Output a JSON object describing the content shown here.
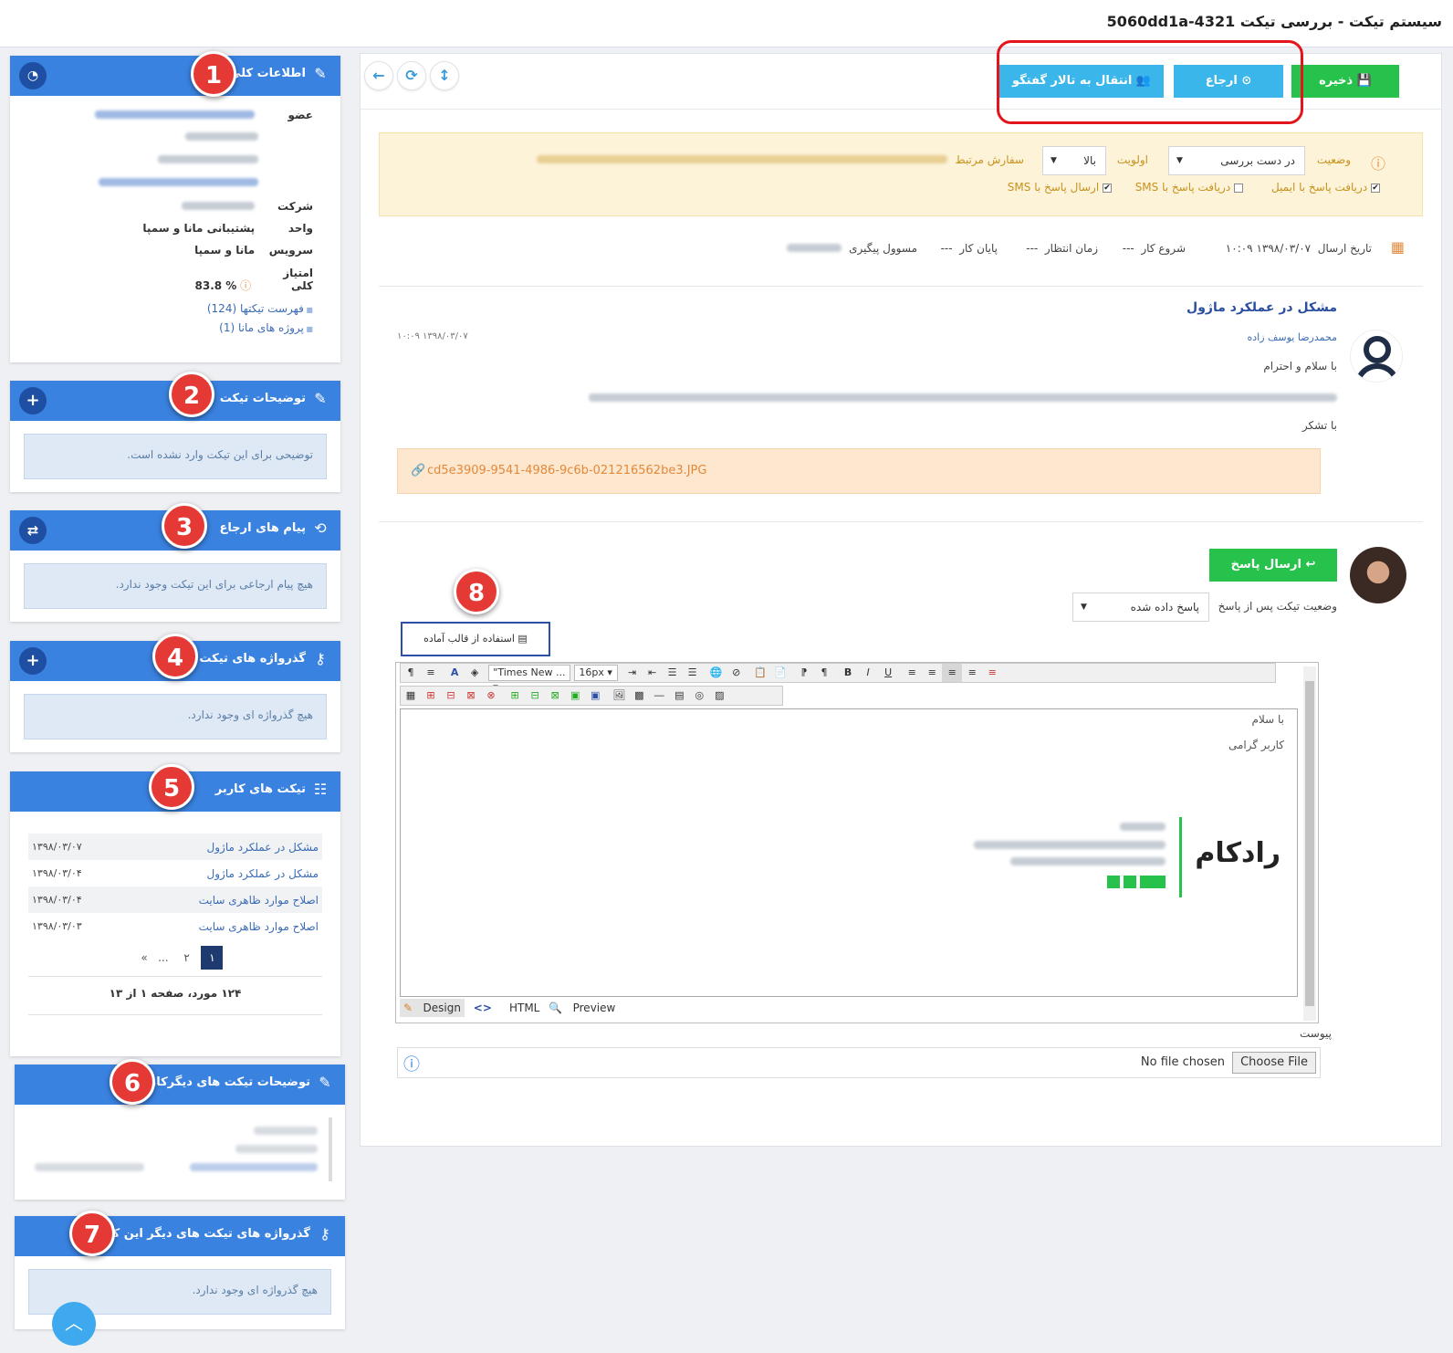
{
  "page": {
    "title": "سیستم تیکت - بررسی تیکت 5060dd1a-4321"
  },
  "toolbar": {
    "save": "ذخیره",
    "refer": "ارجاع",
    "move_forum": "انتقال به تالار گفتگو"
  },
  "badges": [
    "1",
    "2",
    "3",
    "4",
    "5",
    "6",
    "7",
    "8"
  ],
  "general_info": {
    "title": "اطلاعات کلی",
    "member_label": "عضو",
    "company_label": "شرکت",
    "unit_label": "واحد",
    "unit_value": "پشتیبانی مانا و سمپا",
    "service_label": "سرویس",
    "service_value": "مانا و سمپا",
    "score_label": "امتیاز کلی",
    "score_value": "83.8 %",
    "links": [
      "فهرست تیکتها (124)",
      "پروژه های مانا (1)"
    ]
  },
  "ticket_desc": {
    "title": "توضیحات تیکت",
    "empty": "توضیحی برای این تیکت وارد نشده است."
  },
  "refer_msgs": {
    "title": "پیام های ارجاع",
    "empty": "هیچ پیام ارجاعی برای این تیکت وجود ندارد."
  },
  "ticket_passwords": {
    "title": "گذرواژه های تیکت",
    "empty": "هیچ گذرواژه ای وجود ندارد."
  },
  "user_tickets": {
    "title": "تیکت های کاربر",
    "rows": [
      {
        "subject": "مشکل در عملکرد ماژول",
        "date": "۱۳۹۸/۰۳/۰۷"
      },
      {
        "subject": "مشکل در عملکرد ماژول",
        "date": "۱۳۹۸/۰۳/۰۴"
      },
      {
        "subject": "اصلاح موارد ظاهری سایت",
        "date": "۱۳۹۸/۰۳/۰۴"
      },
      {
        "subject": "اصلاح موارد ظاهری سایت",
        "date": "۱۳۹۸/۰۳/۰۳"
      }
    ],
    "pages": [
      "۱",
      "۲",
      "...",
      "»"
    ],
    "summary": "۱۲۴ مورد، صفحه ۱ از ۱۳"
  },
  "other_user_desc": {
    "title": "توضیحات تیکت های دیگرکاربر"
  },
  "other_passwords": {
    "title": "گذرواژه های تیکت های دیگر این کاربر",
    "empty": "هیچ گذرواژه ای وجود ندارد."
  },
  "status_box": {
    "status_label": "وضعیت",
    "status_value": "در دست بررسی",
    "priority_label": "اولویت",
    "priority_value": "بالا",
    "order_label": "سفارش مرتبط",
    "email_check": "دریافت پاسخ با ایمیل",
    "sms_receive": "دریافت پاسخ با SMS",
    "sms_send": "ارسال پاسخ با SMS"
  },
  "meta": {
    "send_date_label": "تاریخ ارسال",
    "send_date_value": "۱۳۹۸/۰۳/۰۷ ۱۰:۰۹",
    "start_label": "شروع کار",
    "start_value": "---",
    "wait_label": "زمان انتظار",
    "wait_value": "---",
    "end_label": "پایان کار",
    "end_value": "---",
    "owner_label": "مسوول پیگیری"
  },
  "message": {
    "title": "مشکل در عملکرد ماژول",
    "author": "محمدرضا یوسف زاده",
    "time": "۱۳۹۸/۰۳/۰۷ ۱۰:۰۹",
    "greeting": "با سلام و احترام",
    "thanks": "با تشکر",
    "attachment": "cd5e3909-9541-4986-9c6b-021216562be3.JPG"
  },
  "reply": {
    "send": "ارسال پاسخ",
    "status_label": "وضعیت تیکت پس از پاسخ",
    "status_value": "پاسخ داده شده",
    "template_btn": "استفاده از قالب آماده",
    "font_name": "\"Times New ...",
    "font_size": "16px",
    "body_line1": "با سلام",
    "body_line2": "کاربر گرامی",
    "signature_logo": "رادکام",
    "mode_design": "Design",
    "mode_html": "HTML",
    "mode_preview": "Preview",
    "attach_label": "پیوست",
    "choose_file": "Choose File",
    "no_file": "No file chosen"
  },
  "colors": {
    "blue_header": "#3a82e0",
    "cyan_btn": "#3ab6ea",
    "green_btn": "#27c24c",
    "badge_red": "#e53935"
  }
}
